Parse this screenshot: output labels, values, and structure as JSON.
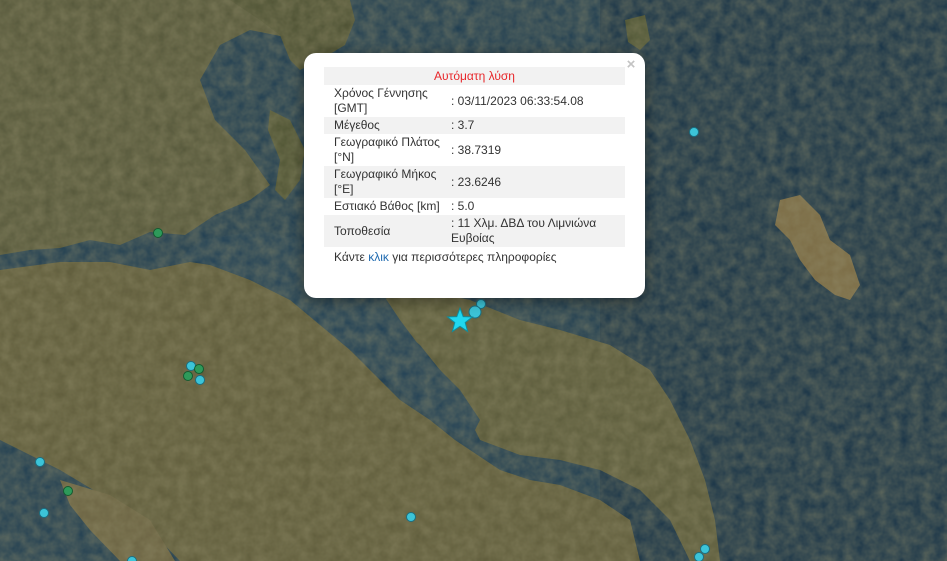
{
  "popup": {
    "close_icon": "×",
    "title": "Αυτόματη λύση",
    "rows": [
      {
        "label": "Χρόνος Γέννησης [GMT]",
        "value": ": 03/11/2023 06:33:54.08"
      },
      {
        "label": "Μέγεθος",
        "value": ": 3.7"
      },
      {
        "label": "Γεωγραφικό Πλάτος [°N]",
        "value": ": 38.7319"
      },
      {
        "label": "Γεωγραφικό Μήκος [°E]",
        "value": ": 23.6246"
      },
      {
        "label": "Εστιακό Βάθος [km]",
        "value": ": 5.0"
      },
      {
        "label": "Τοποθεσία",
        "value": ": 11 Χλμ. ΔΒΔ του Λιμνιώνα Ευβοίας"
      }
    ],
    "more_prefix": "Κάντε ",
    "more_link": "κλικ",
    "more_suffix": " για περισσότερες πληροφορίες"
  },
  "map": {
    "colors": {
      "sea": "#1e3d52",
      "sea_deep": "#14283a",
      "land": "#5b5a37",
      "land_dark": "#3e4a2a",
      "land_light": "#8a7a55",
      "quake_cyan": "#3cc4d8",
      "quake_green": "#2e9a5a",
      "star": "#20d8f0"
    },
    "icons": [
      "epicenter-star-icon",
      "earthquake-marker-icon"
    ]
  }
}
